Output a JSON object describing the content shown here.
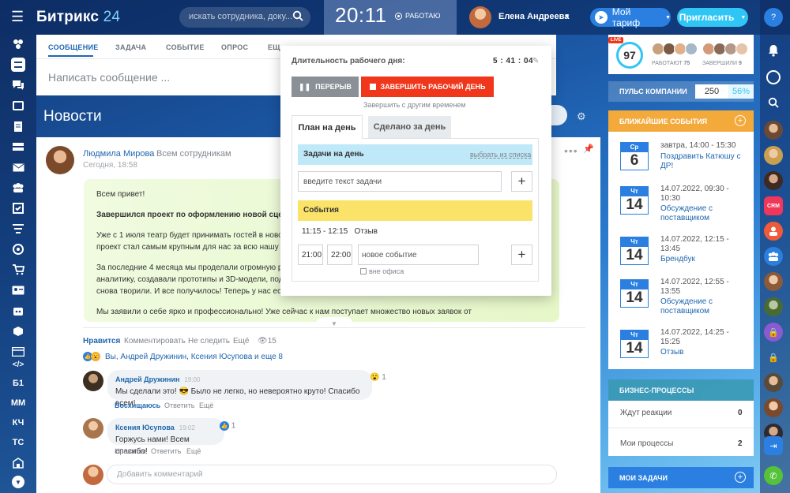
{
  "header": {
    "logo_main": "Битрикс",
    "logo_num": "24",
    "search_placeholder": "искать сотрудника, доку...",
    "clock": "20:11",
    "work_status": "РАБОТАЮ",
    "user_name": "Елена Андреева",
    "tariff_label": "Мой тариф",
    "invite_label": "Пригласить"
  },
  "leftbar": {
    "text_items": [
      "Б1",
      "ММ",
      "КЧ",
      "ТС"
    ]
  },
  "composer": {
    "tabs": [
      "СООБЩЕНИЕ",
      "ЗАДАЧА",
      "СОБЫТИЕ",
      "ОПРОС",
      "ЕЩ"
    ],
    "placeholder": "Написать сообщение ..."
  },
  "feed": {
    "title": "Новости"
  },
  "post": {
    "author": "Людмила Мирова",
    "audience": "Всем сотрудникам",
    "date": "Сегодня, 18:58",
    "paragraphs": [
      "Всем привет!",
      "Завершился проект по оформлению новой сцен",
      "Уже с 1 июля театр будет принимать гостей в ново",
      "проект стал самым крупным для нас за всю нашу и",
      "За последние 4 месяца мы проделали огромную р",
      "аналитику, создавали прототипы и 3D-модели, под",
      "снова творили. И все получилось! Теперь у нас ест",
      "Мы заявили о себе ярко и профессионально! Уже сейчас к нам поступает множество новых заявок от"
    ],
    "actions": {
      "like": "Нравится",
      "comment": "Комментировать",
      "unfollow": "Не следить",
      "more": "Ещё",
      "views": "15"
    },
    "reactions_text": "Вы, Андрей Дружинин, Ксения Юсупова и еще 8"
  },
  "comments": [
    {
      "author": "Андрей Дружинин",
      "time": "19:00",
      "text_a": "Мы сделали это!",
      "text_b": "Было не легко, но невероятно круто! Спасибо всем!",
      "reaction_count": "1",
      "actions": [
        "Восхищаюсь",
        "Ответить",
        "Ещё"
      ]
    },
    {
      "author": "Ксения Юсупова",
      "time": "19:02",
      "text": "Горжусь нами! Всем спасибо!",
      "reaction_count": "1",
      "actions": [
        "Нравится",
        "Ответить",
        "Ещё"
      ]
    }
  ],
  "add_comment_placeholder": "Добавить комментарий",
  "workday": {
    "title": "Длительность рабочего дня:",
    "duration": "5 : 41 : 04",
    "break_label": "ПЕРЕРЫВ",
    "end_label": "ЗАВЕРШИТЬ РАБОЧИЙ ДЕНЬ",
    "end_other": "Завершить с другим временем",
    "tab_plan": "План на день",
    "tab_done": "Сделано за день",
    "tasks_header": "Задачи на день",
    "tasks_pick": "выбрать из списка",
    "task_placeholder": "введите текст задачи",
    "events_header": "События",
    "event_time": "11:15 - 12:15",
    "event_name": "Отзыв",
    "new_from": "21:00",
    "new_to": "22:00",
    "new_event_placeholder": "новое событие",
    "out_of_office": "вне офиса"
  },
  "right": {
    "live": "LIVE",
    "score": "97",
    "working_label": "РАБОТАЮТ",
    "working_count": "75",
    "finished_label": "ЗАВЕРШИЛИ",
    "finished_count": "9",
    "pulse_label": "ПУЛЬС КОМПАНИИ",
    "pulse_value": "250",
    "pulse_percent": "56%",
    "events_label": "БЛИЖАЙШИЕ СОБЫТИЯ",
    "events": [
      {
        "dow": "Ср",
        "day": "6",
        "time": "завтра, 14:00 - 15:30",
        "name": "Поздравить Катюшу с ДР!"
      },
      {
        "dow": "Чт",
        "day": "14",
        "time": "14.07.2022, 09:30 - 10:30",
        "name": "Обсуждение с поставщиком"
      },
      {
        "dow": "Чт",
        "day": "14",
        "time": "14.07.2022, 12:15 - 13:45",
        "name": "Брендбук"
      },
      {
        "dow": "Чт",
        "day": "14",
        "time": "14.07.2022, 12:55 - 13:55",
        "name": "Обсуждение с поставщиком"
      },
      {
        "dow": "Чт",
        "day": "14",
        "time": "14.07.2022, 14:25 - 15:25",
        "name": "Отзыв"
      }
    ],
    "bp_label": "БИЗНЕС-ПРОЦЕССЫ",
    "bp_wait_label": "Ждут реакции",
    "bp_wait_count": "0",
    "bp_mine_label": "Мои процессы",
    "bp_mine_count": "2",
    "tasks_label": "МОИ ЗАДАЧИ"
  },
  "rightbar": {
    "crm_badge": "CRM"
  }
}
